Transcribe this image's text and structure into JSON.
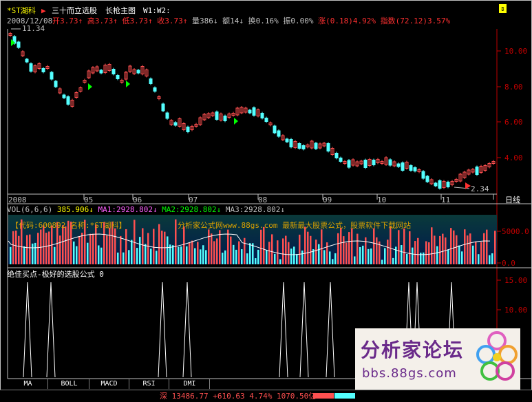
{
  "header": {
    "stock": "*ST湖科",
    "marker": "▶",
    "indicator": "三十而立选股",
    "main_chart": "长枪主图",
    "w_labels": "W1:W2:",
    "date": "2008/12/08",
    "quote": [
      {
        "label": "开",
        "value": "3.73",
        "arrow": "↑",
        "color": "#ff3030"
      },
      {
        "label": "高",
        "value": "3.73",
        "arrow": "↑",
        "color": "#ff3030"
      },
      {
        "label": "低",
        "value": "3.73",
        "arrow": "↑",
        "color": "#ff3030"
      },
      {
        "label": "收",
        "value": "3.73",
        "arrow": "↑",
        "color": "#ff3030"
      },
      {
        "label": "量",
        "value": "386",
        "arrow": "↓",
        "color": "#c0c0c0"
      },
      {
        "label": "额",
        "value": "14",
        "arrow": "↓",
        "color": "#c0c0c0"
      },
      {
        "label": "换",
        "value": "0.16%",
        "arrow": "",
        "color": "#c0c0c0"
      },
      {
        "label": "振",
        "value": "0.00%",
        "arrow": "",
        "color": "#c0c0c0"
      },
      {
        "label": "涨",
        "value": "(0.18)4.92%",
        "arrow": "",
        "color": "#ff3030"
      },
      {
        "label": "指数",
        "value": "(72.12)3.57%",
        "arrow": "",
        "color": "#ff3030"
      }
    ],
    "top_right_icon": "up-down-arrows-icon"
  },
  "price_axis": {
    "ticks": [
      "10.00",
      "8.00",
      "6.00",
      "4.00"
    ],
    "high_label": "11.34",
    "low_label": "2.34"
  },
  "time_axis": {
    "labels": [
      "2008",
      "05",
      "06",
      "07",
      "08",
      "09",
      "10",
      "11"
    ],
    "period": "日线"
  },
  "volume_panel": {
    "legend": [
      {
        "text": "VOL(6,6,6)",
        "color": "#c0c0c0"
      },
      {
        "text": "385.906↓",
        "color": "#ffff00"
      },
      {
        "text": "MA1:2928.802↓",
        "color": "#ff60ff"
      },
      {
        "text": "MA2:2928.802↓",
        "color": "#00ff00"
      },
      {
        "text": "MA3:2928.802↓",
        "color": "#c0c0c0"
      }
    ],
    "watermark_left": "【代码:600892 名称:*ST湖科】",
    "watermark_right": "分析家公式网www.88gs.com 最新最大股票公式，股票软件下载网站",
    "ticks": [
      "5000.0",
      "0.0"
    ]
  },
  "signal_panel": {
    "title": "绝佳买点-极好的选股公式 0",
    "ticks": [
      "15.00",
      "10.00"
    ]
  },
  "tabs": [
    "MA",
    "BOLL",
    "MACD",
    "RSI",
    "DMI"
  ],
  "status": {
    "text": "深 13486.77 +610.63 4.74% 1070.50亿"
  },
  "logo": {
    "title": "分析家论坛",
    "url": "bbs.88gs.com"
  },
  "colors": {
    "up": "#ff5050",
    "down": "#54ffff",
    "axis": "#c00000",
    "grid": "#800000"
  }
}
